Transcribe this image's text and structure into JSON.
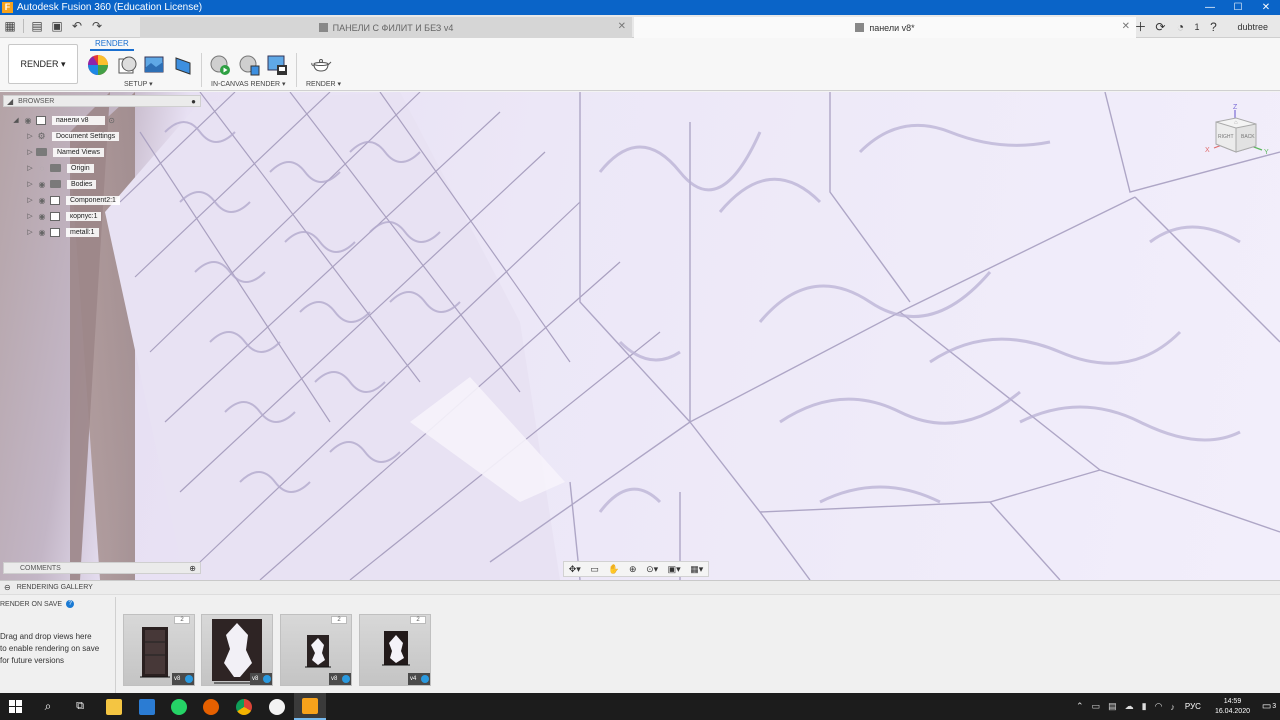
{
  "window": {
    "title": "Autodesk Fusion 360 (Education License)",
    "minimize": "—",
    "maximize": "☐",
    "close": "✕"
  },
  "tabs": [
    {
      "label": "ПАНЕЛИ С ФИЛИТ И БЕЗ v4",
      "active": false
    },
    {
      "label": "панели v8*",
      "active": true
    }
  ],
  "tabbar_right": {
    "job_count": "1",
    "user": "dubtree"
  },
  "ribbon": {
    "workspace": "RENDER ▾",
    "active_tab": "RENDER",
    "groups": [
      {
        "label": "SETUP ▾"
      },
      {
        "label": "IN-CANVAS RENDER ▾"
      },
      {
        "label": "RENDER ▾"
      }
    ]
  },
  "browser": {
    "title": "BROWSER",
    "root": "панели v8",
    "items": [
      {
        "label": "Document Settings"
      },
      {
        "label": "Named Views"
      },
      {
        "label": "Origin"
      },
      {
        "label": "Bodies"
      },
      {
        "label": "Component2:1"
      },
      {
        "label": "корпус:1"
      },
      {
        "label": "metall:1"
      }
    ]
  },
  "comments": {
    "title": "COMMENTS"
  },
  "viewcube": {
    "right": "RIGHT",
    "back": "BACK",
    "x": "X",
    "y": "Y",
    "z": "Z"
  },
  "gallery": {
    "title": "RENDERING GALLERY",
    "render_on_save": "RENDER ON SAVE",
    "help_line1": "Drag and drop views here",
    "help_line2": "to enable rendering on save",
    "help_line3": "for future versions",
    "thumbnails": [
      {
        "count": "2",
        "version": "v8"
      },
      {
        "count": "",
        "version": "v8"
      },
      {
        "count": "2",
        "version": "v8"
      },
      {
        "count": "2",
        "version": "v4"
      }
    ]
  },
  "taskbar": {
    "language": "РУС",
    "time": "14:59",
    "date": "16.04.2020",
    "notifications": "3"
  }
}
